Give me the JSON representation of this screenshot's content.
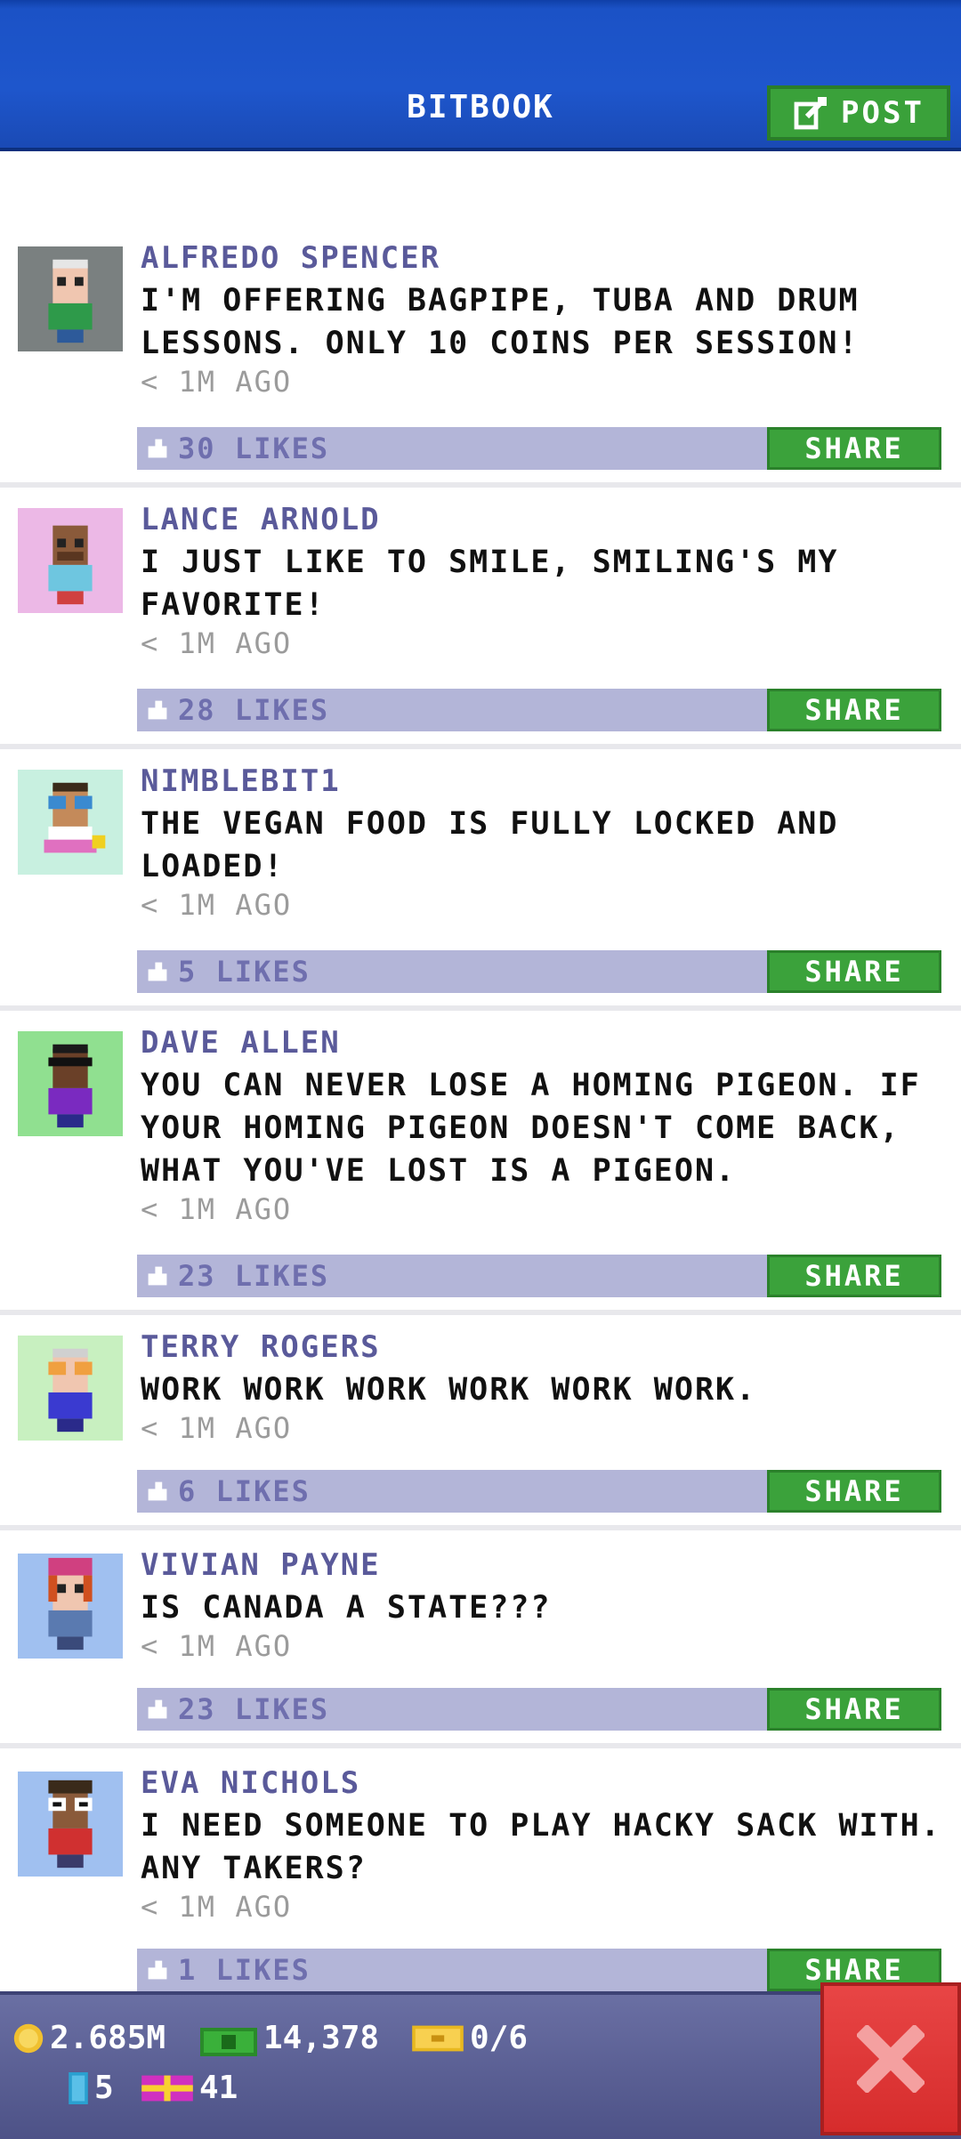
{
  "header": {
    "title": "BITBOOK",
    "post_label": "POST"
  },
  "colors": {
    "header_blue": "#1e56cc",
    "share_green": "#3ba23b",
    "likes_bar": "#b3b5d8",
    "close_red": "#d62c2c"
  },
  "posts": [
    {
      "name": "ALFREDO SPENCER",
      "message": "I'M OFFERING BAGPIPE, TUBA AND DRUM LESSONS. ONLY 10 COINS PER SESSION!",
      "time": "< 1M AGO",
      "likes": "30 LIKES",
      "share": "SHARE"
    },
    {
      "name": "LANCE ARNOLD",
      "message": "I JUST LIKE TO SMILE, SMILING'S MY FAVORITE!",
      "time": "< 1M AGO",
      "likes": "28 LIKES",
      "share": "SHARE"
    },
    {
      "name": "NIMBLEBIT1",
      "message": "THE VEGAN FOOD IS FULLY LOCKED AND LOADED!",
      "time": "< 1M AGO",
      "likes": "5 LIKES",
      "share": "SHARE"
    },
    {
      "name": "DAVE ALLEN",
      "message": "YOU CAN NEVER LOSE A HOMING PIGEON. IF YOUR HOMING PIGEON DOESN'T COME BACK, WHAT YOU'VE LOST IS A PIGEON.",
      "time": "< 1M AGO",
      "likes": "23 LIKES",
      "share": "SHARE"
    },
    {
      "name": "TERRY ROGERS",
      "message": "WORK WORK WORK WORK WORK WORK.",
      "time": "< 1M AGO",
      "likes": "6 LIKES",
      "share": "SHARE"
    },
    {
      "name": "VIVIAN PAYNE",
      "message": "IS CANADA A STATE???",
      "time": "< 1M AGO",
      "likes": "23 LIKES",
      "share": "SHARE"
    },
    {
      "name": "EVA NICHOLS",
      "message": "I NEED SOMEONE TO PLAY HACKY SACK WITH. ANY TAKERS?",
      "time": "< 1M AGO",
      "likes": "1 LIKES",
      "share": "SHARE"
    }
  ],
  "status": {
    "coins": "2.685M",
    "bux": "14,378",
    "tickets": "0/6",
    "elevator": "5",
    "gifts": "41"
  }
}
